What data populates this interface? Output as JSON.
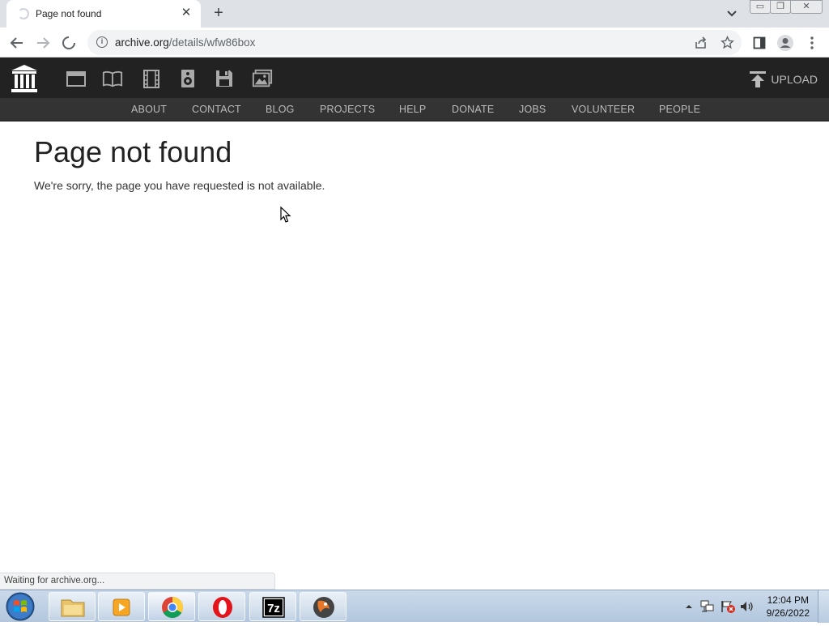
{
  "tab": {
    "title": "Page not found"
  },
  "address": {
    "host": "archive.org",
    "path": "/details/wfw86box"
  },
  "site": {
    "upload_label": "UPLOAD",
    "nav": [
      "ABOUT",
      "CONTACT",
      "BLOG",
      "PROJECTS",
      "HELP",
      "DONATE",
      "JOBS",
      "VOLUNTEER",
      "PEOPLE"
    ]
  },
  "page": {
    "heading": "Page not found",
    "message": "We're sorry, the page you have requested is not available."
  },
  "status_text": "Waiting for archive.org...",
  "taskbar": {
    "time": "12:04 PM",
    "date": "9/26/2022"
  },
  "icons": [
    "tab-spinner-icon",
    "close-icon",
    "plus-icon",
    "chevron-down-icon",
    "back-icon",
    "forward-icon",
    "stop-icon",
    "info-icon",
    "share-icon",
    "star-icon",
    "sidepanel-icon",
    "profile-icon",
    "menu-icon",
    "archive-logo-icon",
    "web-icon",
    "texts-icon",
    "video-icon",
    "audio-icon",
    "software-icon",
    "images-icon",
    "upload-icon"
  ],
  "colors": {
    "header_bg": "#222222",
    "subnav_bg": "#333333",
    "nav_text": "#bbbbbb"
  }
}
